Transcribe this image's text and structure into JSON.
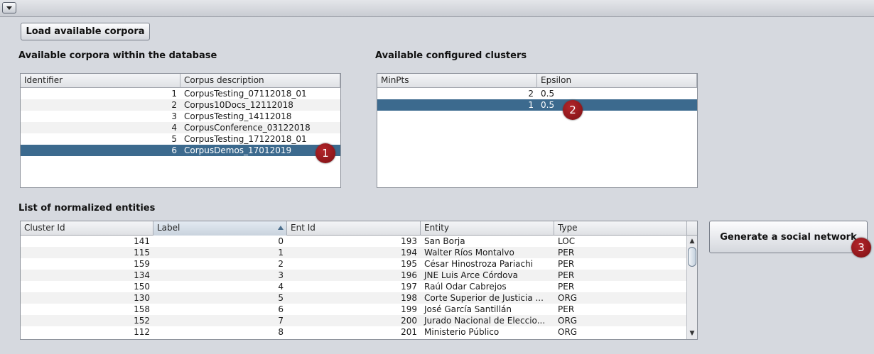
{
  "load_button": "Load available corpora",
  "corpora": {
    "title": "Available corpora within the database",
    "columns": [
      "Identifier",
      "Corpus description"
    ],
    "rows": [
      {
        "id": "1",
        "desc": "CorpusTesting_07112018_01"
      },
      {
        "id": "2",
        "desc": "Corpus10Docs_12112018"
      },
      {
        "id": "3",
        "desc": "CorpusTesting_14112018"
      },
      {
        "id": "4",
        "desc": "CorpusConference_03122018"
      },
      {
        "id": "5",
        "desc": "CorpusTesting_17122018_01"
      },
      {
        "id": "6",
        "desc": "CorpusDemos_17012019"
      }
    ],
    "selected_index": 5,
    "marker": "1"
  },
  "clusters": {
    "title": "Available configured clusters",
    "columns": [
      "MinPts",
      "Epsilon"
    ],
    "rows": [
      {
        "minpts": "2",
        "epsilon": "0.5"
      },
      {
        "minpts": "1",
        "epsilon": "0.5"
      }
    ],
    "selected_index": 1,
    "marker": "2"
  },
  "entities": {
    "title": "List of normalized entities",
    "columns": [
      "Cluster Id",
      "Label",
      "Ent Id",
      "Entity",
      "Type"
    ],
    "sorted_column": "Label",
    "rows": [
      {
        "cluster": "141",
        "label": "0",
        "ent": "193",
        "entity": "San Borja",
        "type": "LOC"
      },
      {
        "cluster": "115",
        "label": "1",
        "ent": "194",
        "entity": "Walter Ríos Montalvo",
        "type": "PER"
      },
      {
        "cluster": "159",
        "label": "2",
        "ent": "195",
        "entity": "César Hinostroza Pariachi",
        "type": "PER"
      },
      {
        "cluster": "134",
        "label": "3",
        "ent": "196",
        "entity": "JNE Luis Arce Córdova",
        "type": "PER"
      },
      {
        "cluster": "150",
        "label": "4",
        "ent": "197",
        "entity": "Raúl Odar Cabrejos",
        "type": "PER"
      },
      {
        "cluster": "130",
        "label": "5",
        "ent": "198",
        "entity": "Corte Superior de Justicia ...",
        "type": "ORG"
      },
      {
        "cluster": "158",
        "label": "6",
        "ent": "199",
        "entity": "José García Santillán",
        "type": "PER"
      },
      {
        "cluster": "152",
        "label": "7",
        "ent": "200",
        "entity": "Jurado Nacional de Eleccio...",
        "type": "ORG"
      },
      {
        "cluster": "112",
        "label": "8",
        "ent": "201",
        "entity": "Ministerio Público",
        "type": "ORG"
      }
    ]
  },
  "generate_button": "Generate a social network",
  "generate_marker": "3",
  "icons": {
    "collapse": "chevron-down-icon",
    "scroll_up": "arrow-up-icon",
    "scroll_down": "arrow-down-icon",
    "sort": "sort-ascending-icon"
  },
  "colors": {
    "selection": "#3c6a8e",
    "marker": "#9b1b20",
    "background": "#d6d9df"
  }
}
